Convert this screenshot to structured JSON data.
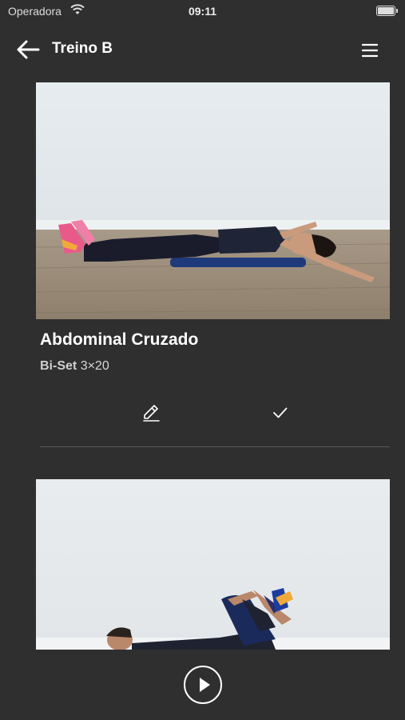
{
  "status_bar": {
    "carrier": "Operadora",
    "time": "09:11"
  },
  "header": {
    "title": "Treino B",
    "back_icon": "arrow-left-icon",
    "menu_icon": "hamburger-menu-icon"
  },
  "exercises": [
    {
      "name": "Abdominal Cruzado",
      "type": "Bi-Set",
      "sets_reps": "3×20",
      "edit_icon": "pencil-icon",
      "done_icon": "check-icon"
    }
  ],
  "footer": {
    "play_icon": "play-icon"
  },
  "colors": {
    "background": "#2f2f2f",
    "text": "#ffffff",
    "divider": "#5a5a5a"
  }
}
